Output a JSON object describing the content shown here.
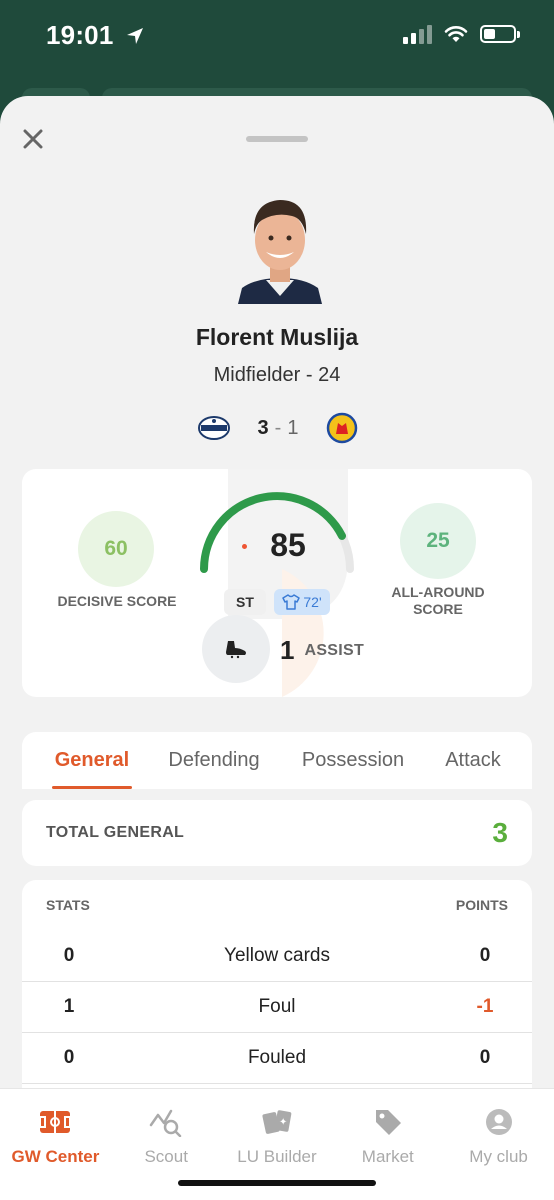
{
  "status": {
    "time": "19:01"
  },
  "player": {
    "name": "Florent Muslija",
    "position_age": "Midfielder - 24"
  },
  "match": {
    "home_score": "3",
    "separator": "-",
    "away_score": "1"
  },
  "scores": {
    "decisive_value": "60",
    "decisive_label": "DECISIVE SCORE",
    "total": "85",
    "gauge_level": 0.85,
    "position_chip": "ST",
    "minutes": "72'",
    "all_around_value": "25",
    "all_around_label": "ALL-AROUND SCORE",
    "assist_count": "1",
    "assist_label": "ASSIST"
  },
  "tabs": [
    {
      "label": "General",
      "active": true
    },
    {
      "label": "Defending",
      "active": false
    },
    {
      "label": "Possession",
      "active": false
    },
    {
      "label": "Attack",
      "active": false
    }
  ],
  "total_general": {
    "label": "TOTAL GENERAL",
    "value": "3"
  },
  "stats": {
    "header_left": "STATS",
    "header_right": "POINTS",
    "rows": [
      {
        "value": "0",
        "name": "Yellow cards",
        "points": "0"
      },
      {
        "value": "1",
        "name": "Foul",
        "points": "-1"
      },
      {
        "value": "0",
        "name": "Fouled",
        "points": "0"
      }
    ]
  },
  "nav": [
    {
      "label": "GW Center",
      "icon": "pitch-icon",
      "active": true
    },
    {
      "label": "Scout",
      "icon": "scout-search-icon",
      "active": false
    },
    {
      "label": "LU Builder",
      "icon": "cards-icon",
      "active": false
    },
    {
      "label": "Market",
      "icon": "tag-icon",
      "active": false
    },
    {
      "label": "My club",
      "icon": "user-icon",
      "active": false
    }
  ],
  "colors": {
    "brand_green": "#1f4a3b",
    "accent": "#e05a2b",
    "positive": "#5aae3c"
  }
}
